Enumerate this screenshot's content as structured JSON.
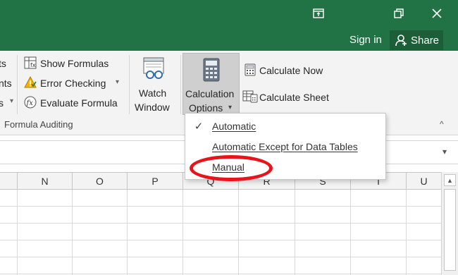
{
  "window": {
    "restore_glyph": "⧉",
    "maximize_glyph": "❐",
    "close_glyph": "✕",
    "sign_in": "Sign in",
    "share": "Share"
  },
  "ribbon": {
    "partial_labels": [
      "ts",
      "nts",
      "s"
    ],
    "show_formulas": "Show Formulas",
    "error_checking": "Error Checking",
    "evaluate_formula": "Evaluate Formula",
    "watch_window_line1": "Watch",
    "watch_window_line2": "Window",
    "calc_options_line1": "Calculation",
    "calc_options_line2": "Options",
    "calculate_now": "Calculate Now",
    "calculate_sheet": "Calculate Sheet",
    "group_label": "Formula Auditing"
  },
  "columns": [
    "N",
    "O",
    "P",
    "Q",
    "R",
    "S",
    "T",
    "U"
  ],
  "menu": {
    "items": [
      {
        "label": "Automatic",
        "checked": true
      },
      {
        "label": "Automatic Except for Data Tables",
        "checked": false
      },
      {
        "label": "Manual",
        "checked": false
      }
    ]
  },
  "colors": {
    "title_green": "#217346",
    "highlight_red": "#e8131b"
  }
}
